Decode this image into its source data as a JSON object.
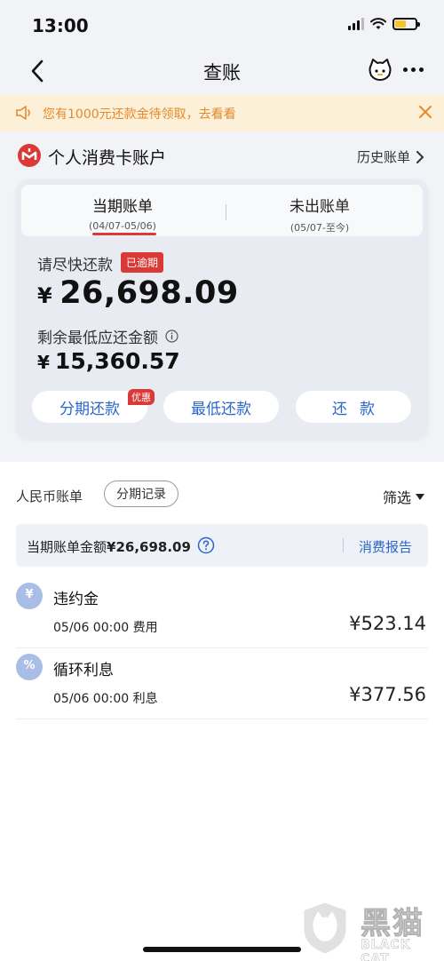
{
  "status_bar": {
    "time": "13:00"
  },
  "nav": {
    "title": "查账"
  },
  "notice": {
    "text": "您有1000元还款金待领取，去看看"
  },
  "account": {
    "title": "个人消费卡账户",
    "history_label": "历史账单"
  },
  "bill_card": {
    "tabs": [
      {
        "label": "当期账单",
        "range": "(04/07-05/06)",
        "active": true
      },
      {
        "label": "未出账单",
        "range": "(05/07-至今)",
        "active": false
      }
    ],
    "repay_label": "请尽快还款",
    "overdue_badge": "已逾期",
    "currency": "¥",
    "amount": "26,698.09",
    "min_label": "剩余最低应还金额",
    "min_amount": "15,360.57",
    "buttons": {
      "installment": "分期还款",
      "promo": "优惠",
      "minimum": "最低还款",
      "repay": "还款"
    }
  },
  "filter": {
    "rmb_label": "人民币账单",
    "installment_chip": "分期记录",
    "filter_label": "筛选"
  },
  "summary": {
    "label": "当期账单金额",
    "amount": "¥26,698.09",
    "report_link": "消费报告"
  },
  "items": [
    {
      "icon": "yen-icon",
      "icon_glyph": "¥",
      "title": "违约金",
      "meta": "05/06 00:00  费用",
      "amount": "¥523.14"
    },
    {
      "icon": "percent-icon",
      "icon_glyph": "%",
      "title": "循环利息",
      "meta": "05/06 00:00  利息",
      "amount": "¥377.56"
    }
  ],
  "watermark": {
    "cn": "黑猫",
    "en": "BLACK CAT"
  },
  "colors": {
    "accent_red": "#d93a36",
    "link_blue": "#2b66c8",
    "notice_bg": "#fdf0d8",
    "notice_text": "#e5892c"
  }
}
